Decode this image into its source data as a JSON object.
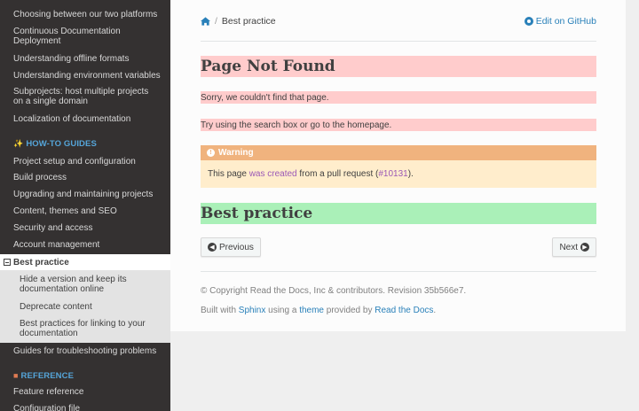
{
  "sidebar": {
    "top_items": [
      "Choosing between our two platforms",
      "Continuous Documentation Deployment",
      "Understanding offline formats",
      "Understanding environment variables",
      "Subprojects: host multiple projects on a single domain",
      "Localization of documentation"
    ],
    "caption_howto": "HOW-TO GUIDES",
    "howto_items": [
      "Project setup and configuration",
      "Build process",
      "Upgrading and maintaining projects",
      "Content, themes and SEO",
      "Security and access",
      "Account management"
    ],
    "current": "Best practice",
    "sub_items": [
      "Hide a version and keep its documentation online",
      "Deprecate content",
      "Best practices for linking to your documentation"
    ],
    "after_item": "Guides for troubleshooting problems",
    "caption_reference": "REFERENCE",
    "reference_items": [
      "Feature reference",
      "Configuration file"
    ]
  },
  "breadcrumb": {
    "current": "Best practice",
    "separator": "/"
  },
  "edit_link": "Edit on GitHub",
  "main": {
    "title": "Page Not Found",
    "sorry_text": "Sorry, we couldn't find that page.",
    "try_text": "Try using the search box or go to the homepage.",
    "warning": {
      "title": "Warning",
      "text_before": "This page ",
      "link_text": "was created",
      "text_middle": " from a pull request (",
      "pr_link": "#10131",
      "text_after": ")."
    },
    "section_title": "Best practice"
  },
  "nav": {
    "previous": "Previous",
    "next": "Next"
  },
  "footer": {
    "copyright": "© Copyright Read the Docs, Inc & contributors. Revision 35b566e7.",
    "built_with": "Built with ",
    "sphinx": "Sphinx",
    "using_a": " using a ",
    "theme": "theme",
    "provided_by": " provided by ",
    "rtd": "Read the Docs",
    "period": "."
  },
  "colors": {
    "sidebar_bg": "#343131",
    "link": "#2980b9",
    "not_found_bg": "#ffcccc",
    "section_bg": "#aaf0b8",
    "warning_head": "#f0b37e",
    "warning_body": "#ffedcc"
  }
}
